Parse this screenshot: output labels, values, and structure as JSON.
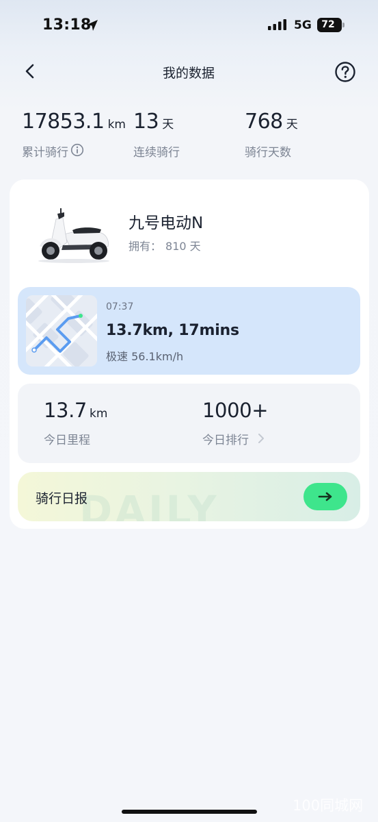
{
  "status_bar": {
    "time": "13:18",
    "network": "5G",
    "battery": "72"
  },
  "nav": {
    "title": "我的数据",
    "back_icon": "chevron-left-icon",
    "help_icon": "question-circle-icon"
  },
  "stats": [
    {
      "value": "17853.1",
      "unit": "km",
      "label": "累计骑行"
    },
    {
      "value": "13",
      "unit": "天",
      "label": "连续骑行"
    },
    {
      "value": "768",
      "unit": "天",
      "label": "骑行天数"
    }
  ],
  "vehicle": {
    "name": "九号电动N",
    "owned_label": "拥有：",
    "owned_value": "810 天"
  },
  "ride": {
    "time": "07:37",
    "summary": "13.7km, 17mins",
    "top_speed": "极速 56.1km/h"
  },
  "today": {
    "mileage_value": "13.7",
    "mileage_unit": "km",
    "mileage_label": "今日里程",
    "rank_value": "1000+",
    "rank_label": "今日排行"
  },
  "daily": {
    "label": "骑行日报",
    "watermark": "DAILY"
  },
  "watermark": "100同城网",
  "colors": {
    "accent_green": "#3ee58c",
    "ride_card_bg": "#d5e6fb",
    "route_line": "#5b9cf0"
  }
}
